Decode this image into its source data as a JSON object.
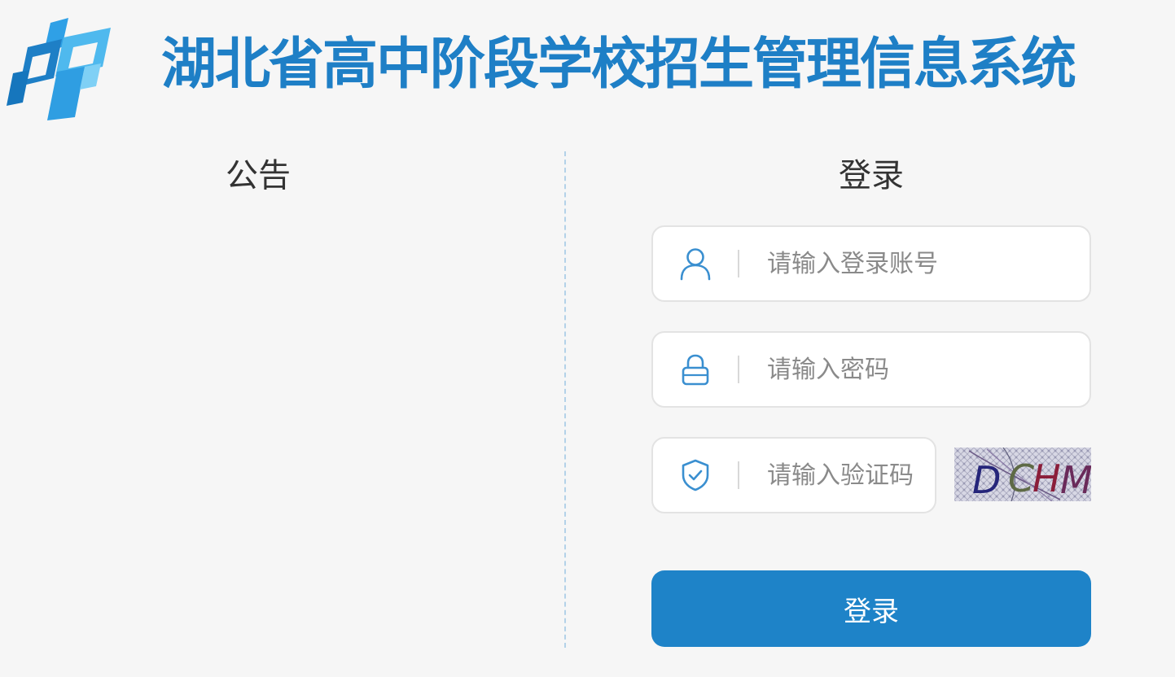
{
  "header": {
    "title": "湖北省高中阶段学校招生管理信息系统",
    "logo_icon": "brand-logo-icon"
  },
  "notice": {
    "heading": "公告"
  },
  "login": {
    "heading": "登录",
    "account": {
      "icon": "user-icon",
      "placeholder": "请输入登录账号",
      "value": ""
    },
    "password": {
      "icon": "lock-icon",
      "placeholder": "请输入密码",
      "value": ""
    },
    "captcha": {
      "icon": "shield-check-icon",
      "placeholder": "请输入验证码",
      "value": "",
      "image_text": "DCHM"
    },
    "submit_label": "登录"
  },
  "colors": {
    "brand": "#1e7fc6",
    "button": "#1e83c8",
    "background": "#f6f6f6",
    "icon": "#3a8fd0"
  }
}
